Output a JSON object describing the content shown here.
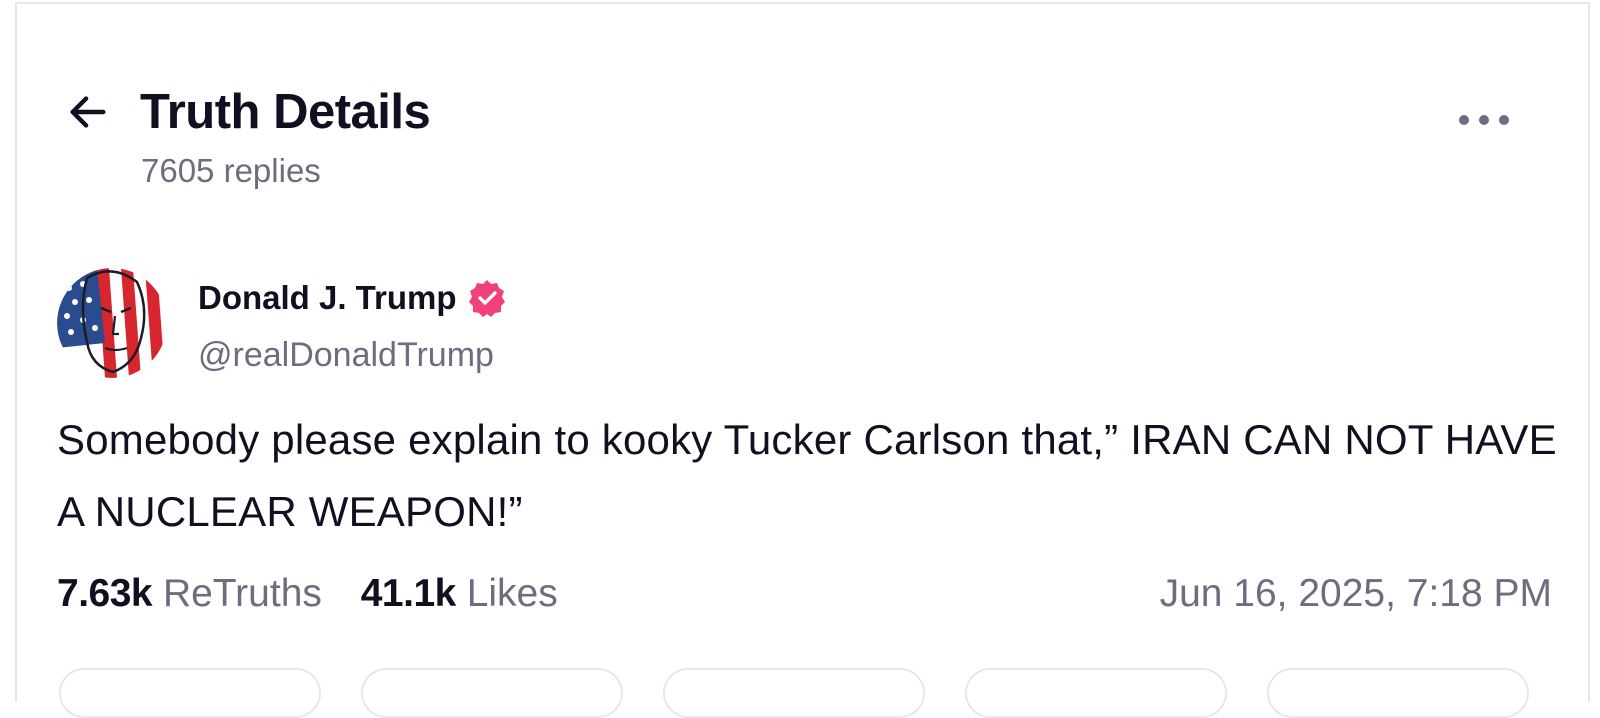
{
  "header": {
    "title": "Truth Details",
    "replies_text": "7605 replies",
    "back_icon": "arrow-left-icon",
    "more_icon": "ellipsis-horizontal-icon"
  },
  "post": {
    "author": {
      "name": "Donald J. Trump",
      "handle": "@realDonaldTrump",
      "verified": true,
      "verified_color": "#f0417a"
    },
    "text": "Somebody please explain to kooky Tucker Carlson that,” IRAN CAN NOT HAVE A NUCLEAR WEAPON!”",
    "stats": {
      "retruths_count": "7.63k",
      "retruths_label": "ReTruths",
      "likes_count": "41.1k",
      "likes_label": "Likes"
    },
    "timestamp": "Jun 16, 2025, 7:18 PM"
  },
  "colors": {
    "text_primary": "#0f1020",
    "text_secondary": "#6c6e80",
    "border": "#e6e7ec"
  }
}
